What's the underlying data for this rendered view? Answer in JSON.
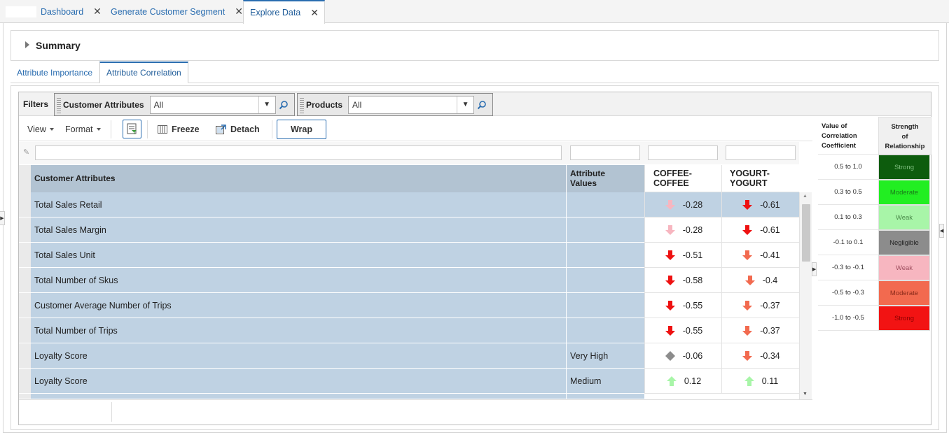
{
  "tabs": [
    {
      "label": "Dashboard",
      "active": false
    },
    {
      "label": "Generate Customer Segment",
      "active": false
    },
    {
      "label": "Explore Data",
      "active": true
    }
  ],
  "summary": {
    "title": "Summary"
  },
  "subtabs": [
    {
      "label": "Attribute Importance",
      "active": false
    },
    {
      "label": "Attribute Correlation",
      "active": true
    }
  ],
  "filters": {
    "label": "Filters",
    "customer_attributes": {
      "name": "Customer Attributes",
      "value": "All"
    },
    "products": {
      "name": "Products",
      "value": "All"
    }
  },
  "toolbar": {
    "view": "View",
    "format": "Format",
    "freeze": "Freeze",
    "detach": "Detach",
    "wrap": "Wrap"
  },
  "grid": {
    "headers": {
      "customer_attributes": "Customer Attributes",
      "attribute_values_1": "Attribute",
      "attribute_values_2": "Values",
      "coffee_1": "COFFEE-",
      "coffee_2": "COFFEE",
      "yogurt_1": "YOGURT-",
      "yogurt_2": "YOGURT"
    },
    "rows": [
      {
        "attribute": "Total Sales Retail",
        "value": "",
        "coffee": "-0.28",
        "coffee_ind": "weak-neg",
        "yogurt": "-0.61",
        "yogurt_ind": "strong-neg",
        "selected": true
      },
      {
        "attribute": "Total Sales Margin",
        "value": "",
        "coffee": "-0.28",
        "coffee_ind": "weak-neg",
        "yogurt": "-0.61",
        "yogurt_ind": "strong-neg"
      },
      {
        "attribute": "Total Sales Unit",
        "value": "",
        "coffee": "-0.51",
        "coffee_ind": "strong-neg",
        "yogurt": "-0.41",
        "yogurt_ind": "moderate-neg"
      },
      {
        "attribute": "Total Number of Skus",
        "value": "",
        "coffee": "-0.58",
        "coffee_ind": "strong-neg",
        "yogurt": "-0.4",
        "yogurt_ind": "moderate-neg"
      },
      {
        "attribute": "Customer Average Number of Trips",
        "value": "",
        "coffee": "-0.55",
        "coffee_ind": "strong-neg",
        "yogurt": "-0.37",
        "yogurt_ind": "moderate-neg"
      },
      {
        "attribute": "Total Number of Trips",
        "value": "",
        "coffee": "-0.55",
        "coffee_ind": "strong-neg",
        "yogurt": "-0.37",
        "yogurt_ind": "moderate-neg"
      },
      {
        "attribute": "Loyalty Score",
        "value": "Very High",
        "coffee": "-0.06",
        "coffee_ind": "negligible",
        "yogurt": "-0.34",
        "yogurt_ind": "moderate-neg"
      },
      {
        "attribute": "Loyalty Score",
        "value": "Medium",
        "coffee": "0.12",
        "coffee_ind": "weak-pos",
        "yogurt": "0.11",
        "yogurt_ind": "weak-pos"
      }
    ]
  },
  "legend": {
    "header_value": [
      "Value of",
      "Correlation",
      "Coefficient"
    ],
    "header_strength": [
      "Strength",
      "of",
      "Relationship"
    ],
    "rows": [
      {
        "range": "0.5 to 1.0",
        "label": "Strong",
        "color": "#0d5c0d",
        "text_color": "#7fbf7f"
      },
      {
        "range": "0.3 to 0.5",
        "label": "Moderate",
        "color": "#22ee22",
        "text_color": "#1a7a1a"
      },
      {
        "range": "0.1 to 0.3",
        "label": "Weak",
        "color": "#a8f5a8",
        "text_color": "#4a8a4a"
      },
      {
        "range": "-0.1 to 0.1",
        "label": "Negligible",
        "color": "#8c8c8c",
        "text_color": "#222222"
      },
      {
        "range": "-0.3 to -0.1",
        "label": "Weak",
        "color": "#f7b6c0",
        "text_color": "#a05060"
      },
      {
        "range": "-0.5 to -0.3",
        "label": "Moderate",
        "color": "#f26a4f",
        "text_color": "#8a2a1a"
      },
      {
        "range": "-1.0 to -0.5",
        "label": "Strong",
        "color": "#f21313",
        "text_color": "#8a0000"
      }
    ]
  },
  "colors": {
    "accent": "#2a6db0",
    "row_bg": "#bfd2e3",
    "header_bg": "#b2c3d2"
  }
}
